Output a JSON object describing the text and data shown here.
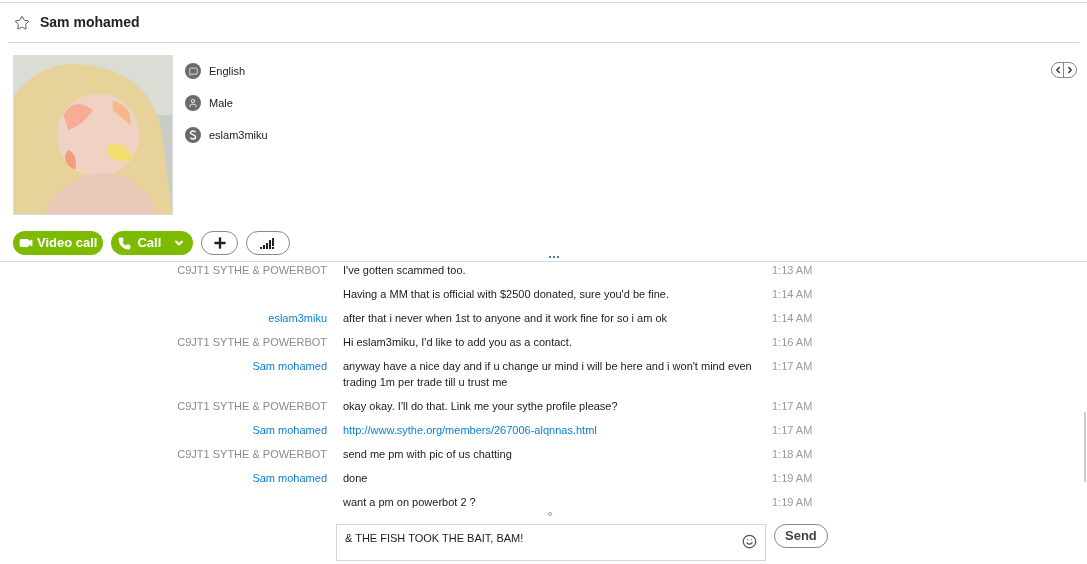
{
  "header": {
    "title": "Sam mohamed",
    "favorite": false
  },
  "profile": {
    "details": [
      {
        "kind": "language",
        "text": "English"
      },
      {
        "kind": "gender",
        "text": "Male"
      },
      {
        "kind": "skype",
        "text": "eslam3miku"
      }
    ]
  },
  "actions": {
    "video_call": "Video call",
    "call": "Call"
  },
  "messages": [
    {
      "sender": "C9JT1 SYTHE & POWERBOT",
      "outgoing": true,
      "kind": "text",
      "text": "I've gotten scammed too.",
      "time": "1:13 AM"
    },
    {
      "kind": "text",
      "text": "Having a MM that is official with $2500 donated, sure you'd be fine.",
      "time": "1:14 AM"
    },
    {
      "sender": "eslam3miku",
      "outgoing": false,
      "kind": "text",
      "text": "after that i never when 1st to anyone and it work fine for so i am ok",
      "time": "1:14 AM"
    },
    {
      "sender": "C9JT1 SYTHE & POWERBOT",
      "outgoing": true,
      "kind": "text",
      "text": "Hi eslam3miku, I'd like to add you as a contact.",
      "time": "1:16 AM"
    },
    {
      "sender": "Sam mohamed",
      "outgoing": false,
      "kind": "text",
      "text": "anyway have a nice day and if u change ur mind i will be here and i won't mind even trading 1m per trade till u trust me",
      "time": "1:17 AM"
    },
    {
      "sender": "C9JT1 SYTHE & POWERBOT",
      "outgoing": true,
      "kind": "text",
      "text": "okay okay. I'll do that. Link me your sythe profile please?",
      "time": "1:17 AM"
    },
    {
      "sender": "Sam mohamed",
      "outgoing": false,
      "kind": "link",
      "text": "http://www.sythe.org/members/267006-alqnnas.html",
      "time": "1:17 AM"
    },
    {
      "sender": "C9JT1 SYTHE & POWERBOT",
      "outgoing": true,
      "kind": "text",
      "text": "send me pm with pic of us chatting",
      "time": "1:18 AM"
    },
    {
      "sender": "Sam mohamed",
      "outgoing": false,
      "kind": "text",
      "text": "done",
      "time": "1:19 AM"
    },
    {
      "kind": "text",
      "text": "want a pm on powerbot 2 ?",
      "time": "1:19 AM"
    }
  ],
  "composer": {
    "value": "& THE FISH TOOK THE BAIT, BAM!",
    "send": "Send"
  }
}
